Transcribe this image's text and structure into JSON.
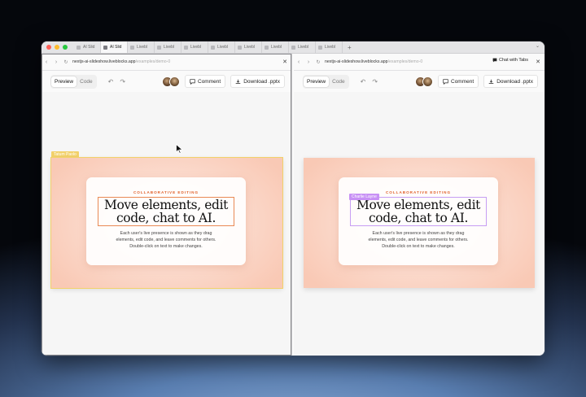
{
  "browser": {
    "tabs": [
      {
        "label": "AI Slid",
        "active": false
      },
      {
        "label": "AI Slid",
        "active": true
      },
      {
        "label": "Livebl",
        "active": false
      },
      {
        "label": "Livebl",
        "active": false
      },
      {
        "label": "Livebl",
        "active": false
      },
      {
        "label": "Livebl",
        "active": false
      },
      {
        "label": "Livebl",
        "active": false
      },
      {
        "label": "Livebl",
        "active": false
      },
      {
        "label": "Livebl",
        "active": false
      },
      {
        "label": "Livebl",
        "active": false
      }
    ],
    "new_tab": "+",
    "traffic_lights": [
      "#ff5f57",
      "#febc2e",
      "#28c840"
    ]
  },
  "left_pane": {
    "url_host": "nextjs-ai-slideshow.liveblocks.app",
    "url_path": "/examples/demo-0",
    "toolbar": {
      "preview": "Preview",
      "code": "Code",
      "comment": "Comment",
      "download": "Download .pptx"
    },
    "cursor_label": "Tatum Paolo",
    "cursor_color": "#f2d16a",
    "slide": {
      "eyebrow": "COLLABORATIVE EDITING",
      "headline_line1": "Move elements, edit",
      "headline_line2": "code, chat to AI.",
      "body_line1": "Each user's live presence is shown as they drag",
      "body_line2": "elements, edit code, and leave comments for others.",
      "body_line3": "Double-click on text to make changes."
    }
  },
  "right_pane": {
    "url_host": "nextjs-ai-slideshow.liveblocks.app",
    "url_path": "/examples/demo-0",
    "chat_with_tabs": "Chat with Tabs",
    "toolbar": {
      "preview": "Preview",
      "code": "Code",
      "comment": "Comment",
      "download": "Download .pptx"
    },
    "cursor_label": "Charlie Layne",
    "cursor_color": "#c891f5",
    "slide": {
      "eyebrow": "COLLABORATIVE EDITING",
      "headline_line1": "Move elements, edit",
      "headline_line2": "code, chat to AI.",
      "body_line1": "Each user's live presence is shown as they drag",
      "body_line2": "elements, edit code, and leave comments for others.",
      "body_line3": "Double-click on text to make changes."
    }
  }
}
